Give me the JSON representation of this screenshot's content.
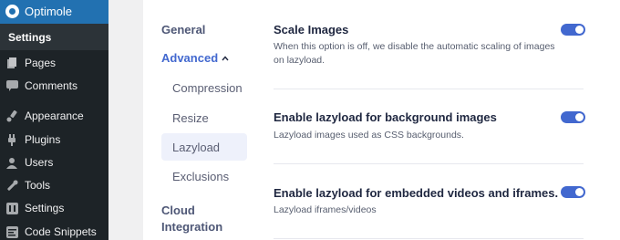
{
  "wp_sidebar": {
    "plugin_label": "Optimole",
    "current_submenu": "Settings",
    "items": [
      {
        "icon": "pages-icon",
        "label": "Pages"
      },
      {
        "icon": "comments-icon",
        "label": "Comments"
      },
      {
        "icon": "appearance-icon",
        "label": "Appearance"
      },
      {
        "icon": "plugins-icon",
        "label": "Plugins"
      },
      {
        "icon": "users-icon",
        "label": "Users"
      },
      {
        "icon": "tools-icon",
        "label": "Tools"
      },
      {
        "icon": "settings-icon",
        "label": "Settings"
      },
      {
        "icon": "code-snippets-icon",
        "label": "Code Snippets"
      }
    ]
  },
  "settings_nav": {
    "general": "General",
    "advanced": "Advanced",
    "advanced_children": [
      "Compression",
      "Resize",
      "Lazyload",
      "Exclusions"
    ],
    "active_child": "Lazyload",
    "cloud_integration_line1": "Cloud",
    "cloud_integration_line2": "Integration"
  },
  "settings": [
    {
      "title": "Scale Images",
      "description_line1": "When this option is off, we disable the automatic scaling of images",
      "description_line2": "on lazyload.",
      "enabled": true
    },
    {
      "title": "Enable lazyload for background images",
      "description_line1": "Lazyload images used as CSS backgrounds.",
      "description_line2": "",
      "enabled": true
    },
    {
      "title": "Enable lazyload for embedded videos and iframes.",
      "description_line1": "Lazyload iframes/videos",
      "description_line2": "",
      "enabled": true
    }
  ],
  "colors": {
    "wp_admin_bg": "#1d2327",
    "wp_highlight": "#2271b1",
    "accent": "#4268cf",
    "active_nav_bg": "#eef1fb"
  }
}
